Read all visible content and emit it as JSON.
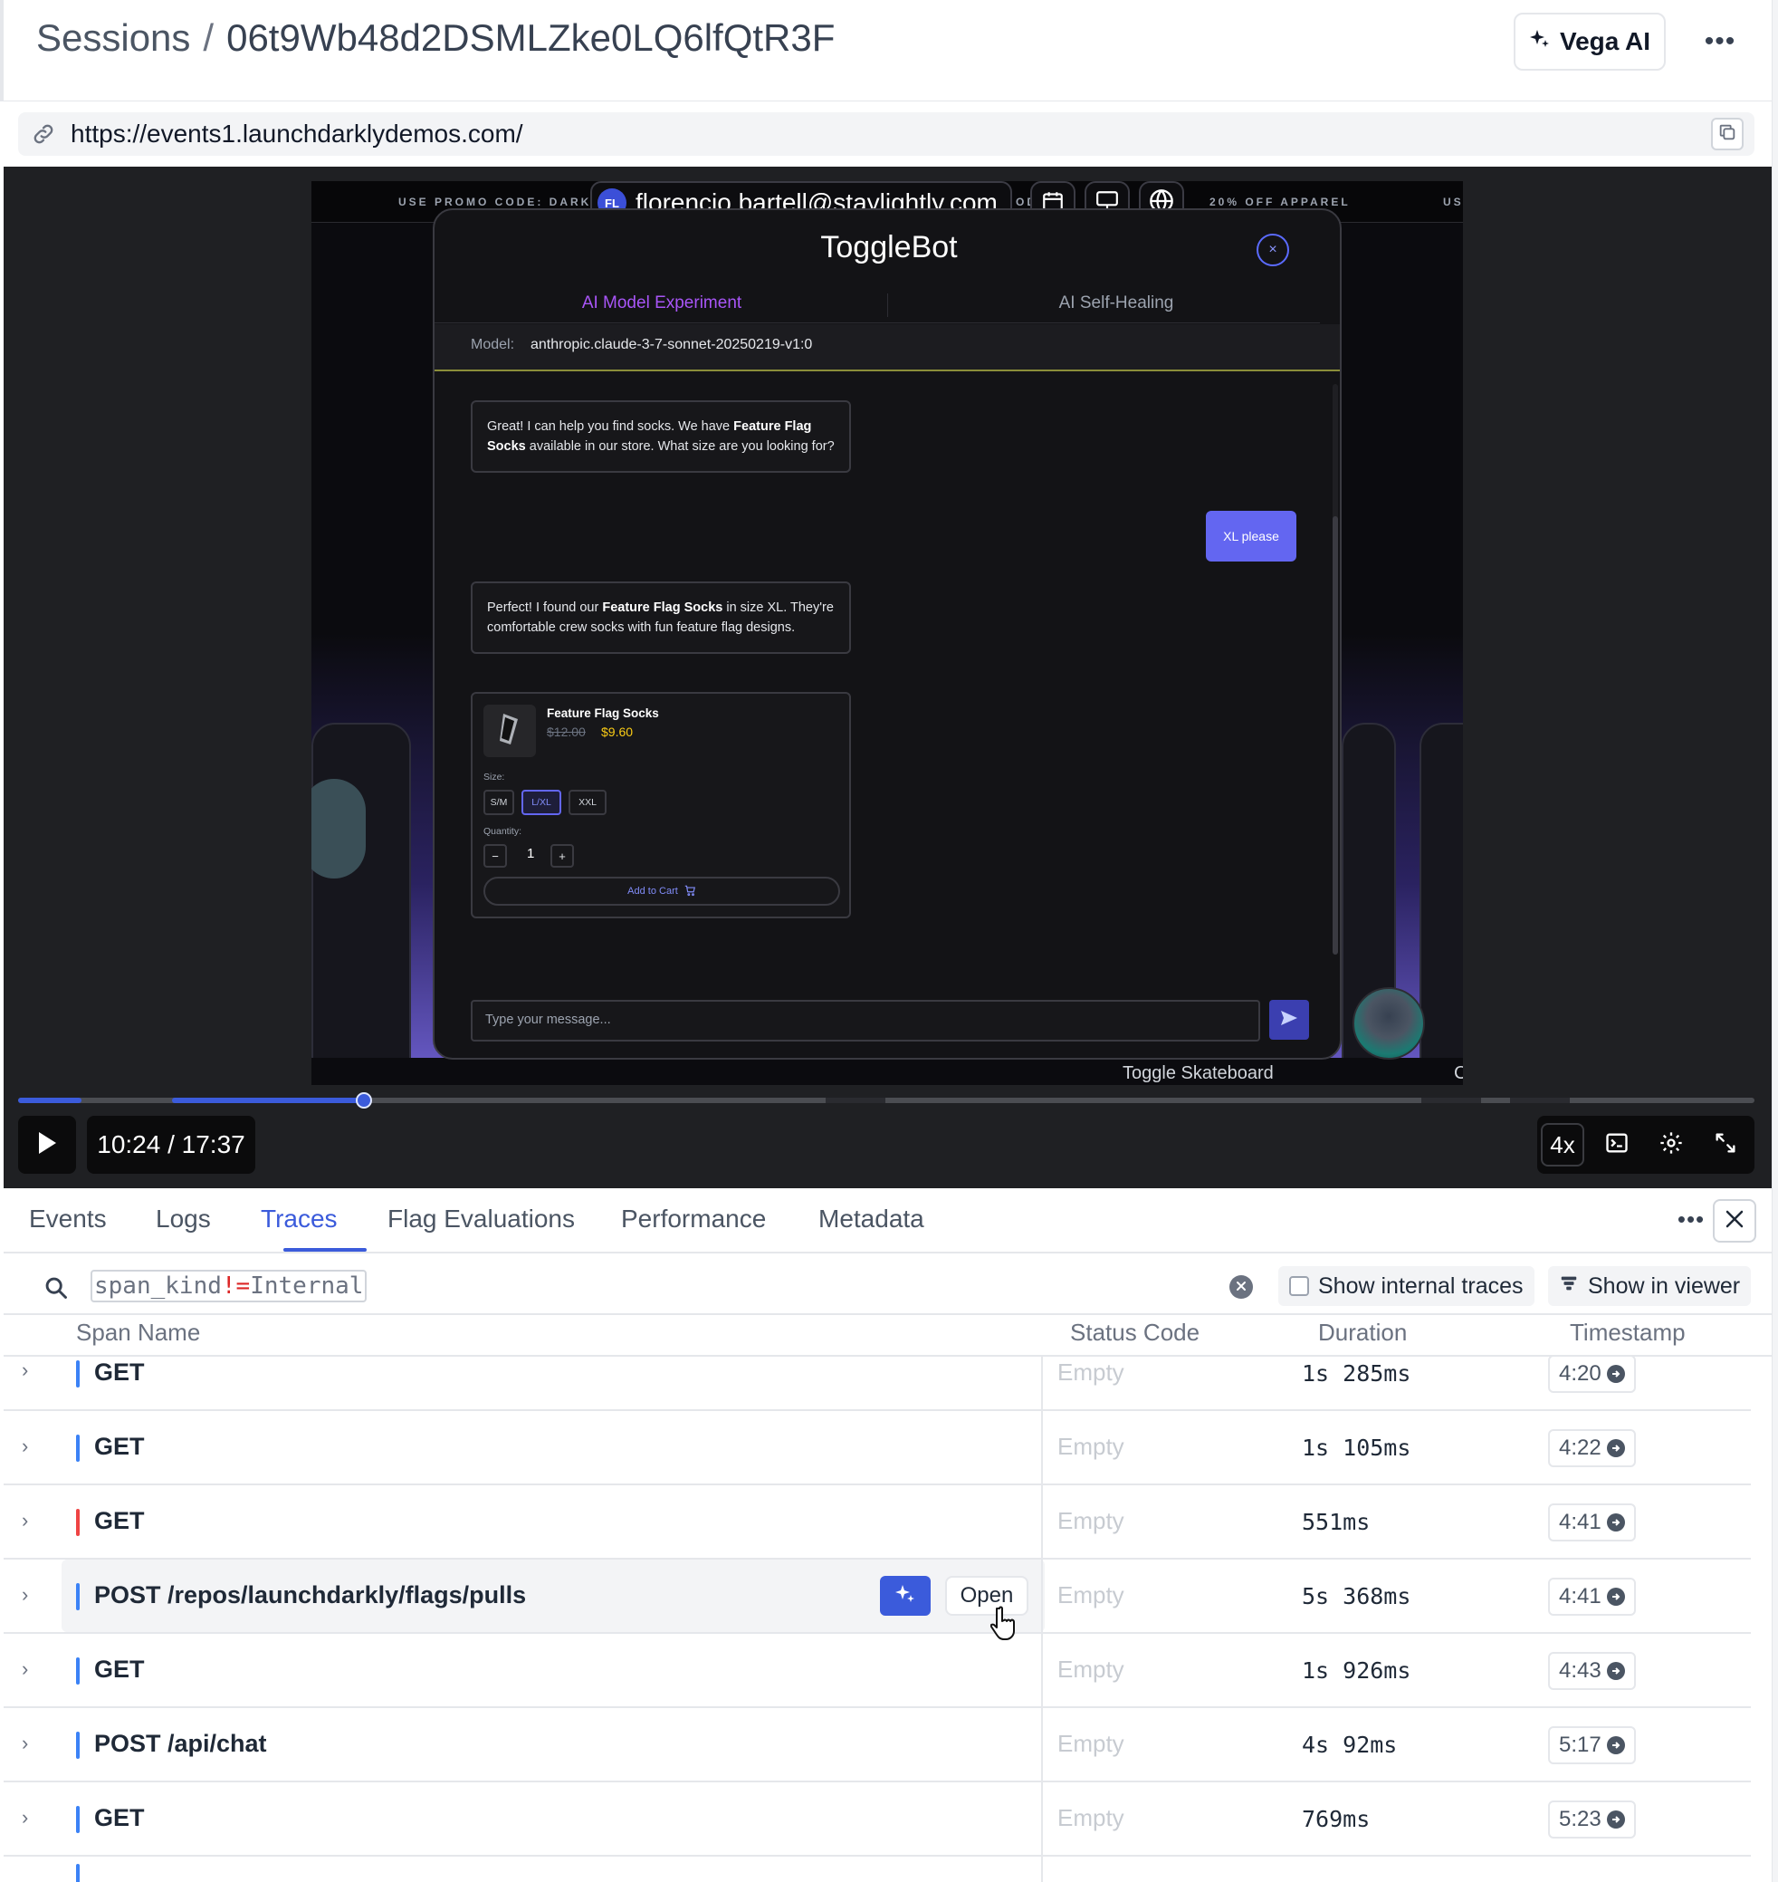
{
  "header": {
    "breadcrumb_root": "Sessions",
    "breadcrumb_sep": "/",
    "session_id": "06t9Wb48d2DSMLZke0LQ6lfQtR3F",
    "vega_label": "Vega AI",
    "more_label": "•••"
  },
  "url_bar": {
    "url": "https://events1.launchdarklydemos.com/"
  },
  "recording": {
    "promo_left": "USE PROMO CODE: DARKLYZ",
    "promo_mid": "OD",
    "promo_right": "20% OFF APPAREL",
    "promo_far": "US",
    "user_initials": "FL",
    "user_email": "florencio.bartell@staylightly.com",
    "bottom_label": "Toggle Skateboard",
    "bottom_label_right": "C",
    "chat": {
      "title": "ToggleBot",
      "close": "×",
      "tab_active": "AI Model Experiment",
      "tab_inactive": "AI Self-Healing",
      "model_key": "Model:",
      "model_value": "anthropic.claude-3-7-sonnet-20250219-v1:0",
      "bot_msg_1": {
        "p1": "Great! I can help you find socks. We have ",
        "b1": "Feature Flag Socks",
        "p2": " available in our store. What size are you looking for?"
      },
      "user_msg": "XL please",
      "bot_msg_2": {
        "p1": "Perfect! I found our ",
        "b1": "Feature Flag Socks",
        "p2": " in size XL. They're comfortable crew socks with fun feature flag designs."
      },
      "product": {
        "name": "Feature Flag Socks",
        "old_price": "$12.00",
        "price": "$9.60",
        "size_label": "Size:",
        "sizes": [
          "S/M",
          "L/XL",
          "XXL"
        ],
        "selected_size": "L/XL",
        "quantity_label": "Quantity:",
        "minus": "−",
        "quantity": "1",
        "plus": "+",
        "add_to_cart": "Add to Cart"
      },
      "input_placeholder": "Type your message..."
    }
  },
  "player": {
    "time": "10:24 / 17:37",
    "speed": "4x",
    "progress": 0.199
  },
  "tabs": [
    "Events",
    "Logs",
    "Traces",
    "Flag Evaluations",
    "Performance",
    "Metadata"
  ],
  "active_tab": "Traces",
  "filter": {
    "query_key": "span_kind",
    "query_op": "!=",
    "query_val": "Internal",
    "show_internal_label": "Show internal traces",
    "show_internal_checked": false,
    "show_viewer_label": "Show in viewer"
  },
  "table": {
    "columns": [
      "Span Name",
      "Status Code",
      "Duration",
      "Timestamp"
    ],
    "open_label": "Open",
    "rows": [
      {
        "name": "GET",
        "status": "Empty",
        "duration": "1s 285ms",
        "timestamp": "4:20",
        "bar_color": "#3b82f6"
      },
      {
        "name": "GET",
        "status": "Empty",
        "duration": "1s 105ms",
        "timestamp": "4:22",
        "bar_color": "#3b82f6"
      },
      {
        "name": "GET",
        "status": "Empty",
        "duration": "551ms",
        "timestamp": "4:41",
        "bar_color": "#ef4444"
      },
      {
        "name": "POST /repos/launchdarkly/flags/pulls",
        "status": "Empty",
        "duration": "5s 368ms",
        "timestamp": "4:41",
        "bar_color": "#3b82f6"
      },
      {
        "name": "GET",
        "status": "Empty",
        "duration": "1s 926ms",
        "timestamp": "4:43",
        "bar_color": "#3b82f6"
      },
      {
        "name": "POST /api/chat",
        "status": "Empty",
        "duration": "4s 92ms",
        "timestamp": "5:17",
        "bar_color": "#3b82f6"
      },
      {
        "name": "GET",
        "status": "Empty",
        "duration": "769ms",
        "timestamp": "5:23",
        "bar_color": "#3b82f6"
      }
    ]
  },
  "colors": {
    "accent": "#3b5bdb",
    "chat_accent": "#6366f1",
    "price": "#facc15",
    "error_bar": "#ef4444",
    "ok_bar": "#3b82f6"
  }
}
